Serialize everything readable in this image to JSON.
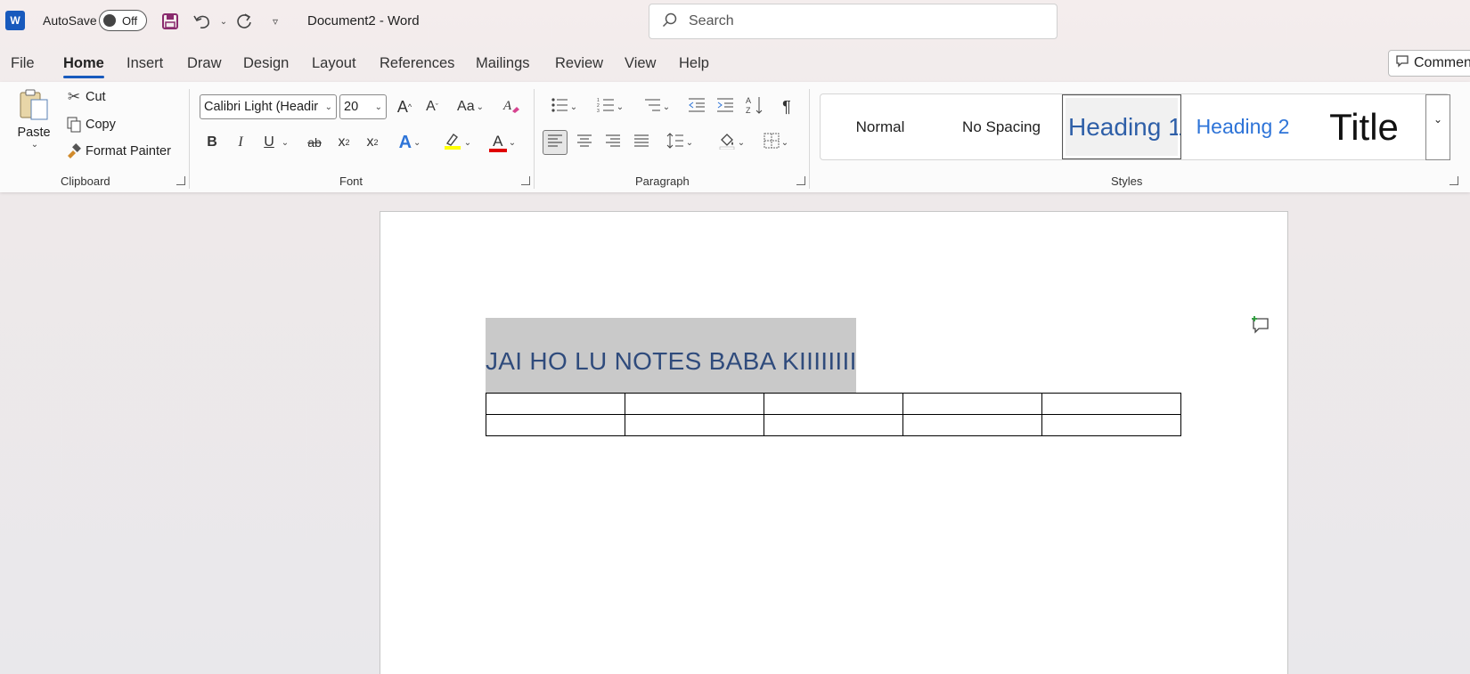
{
  "titlebar": {
    "logo": "W",
    "autosave_label": "AutoSave",
    "autosave_state": "Off",
    "doc_title": "Document2  -  Word",
    "search_placeholder": "Search"
  },
  "menu": {
    "tabs": [
      "File",
      "Home",
      "Insert",
      "Draw",
      "Design",
      "Layout",
      "References",
      "Mailings",
      "Review",
      "View",
      "Help"
    ],
    "active": "Home",
    "comments_label": "Commen"
  },
  "ribbon": {
    "clipboard": {
      "label": "Clipboard",
      "paste": "Paste",
      "cut": "Cut",
      "copy": "Copy",
      "format_painter": "Format Painter"
    },
    "font": {
      "label": "Font",
      "font_name": "Calibri Light (Headir",
      "font_size": "20",
      "grow": "A",
      "shrink": "A",
      "change_case": "Aa",
      "bold": "B",
      "italic": "I",
      "underline": "U",
      "strike": "ab",
      "subscript": "x",
      "superscript": "x",
      "text_effects": "A",
      "font_color": "A",
      "highlight_color": "#ffff00",
      "font_color_value": "#e00000"
    },
    "paragraph": {
      "label": "Paragraph"
    },
    "styles": {
      "label": "Styles",
      "items": [
        "Normal",
        "No Spacing",
        "Heading 1",
        "Heading 2",
        "Title"
      ],
      "selected": "Heading 1"
    }
  },
  "document": {
    "heading": "JAI HO LU NOTES BABA KIIIIIIII",
    "table": {
      "rows": 2,
      "cols": 5
    }
  }
}
